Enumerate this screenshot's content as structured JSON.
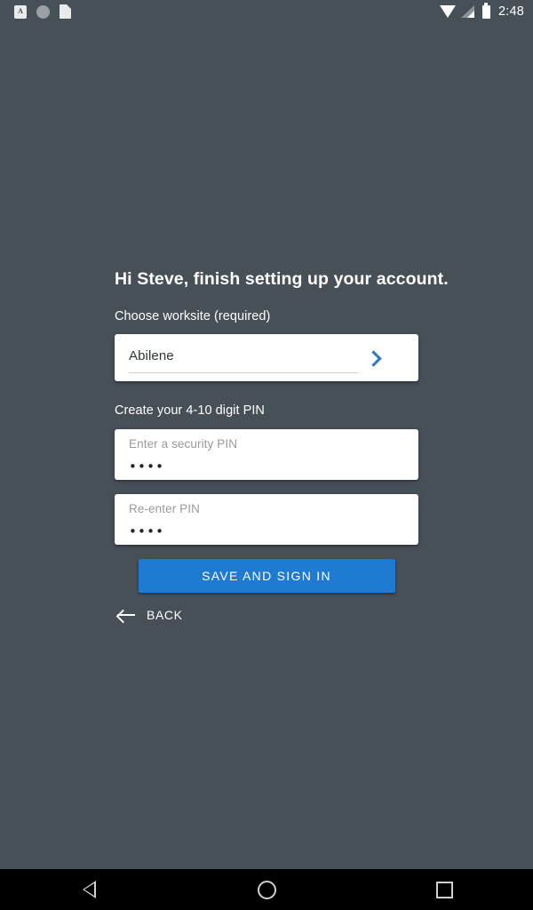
{
  "status_bar": {
    "left_icons": [
      {
        "name": "app-badge-a-icon",
        "glyph": "A"
      },
      {
        "name": "circle-notification-icon",
        "glyph": ""
      },
      {
        "name": "document-notification-icon",
        "glyph": ""
      }
    ],
    "right_icons": [
      {
        "name": "wifi-icon"
      },
      {
        "name": "cellular-signal-icon"
      },
      {
        "name": "battery-icon"
      }
    ],
    "time": "2:48"
  },
  "screen": {
    "title": "Hi Steve, finish setting up your account.",
    "worksite": {
      "label": "Choose worksite (required)",
      "value": "Abilene",
      "chevron_icon": "chevron-right-icon"
    },
    "pin": {
      "section_label": "Create your 4-10 digit PIN",
      "enter": {
        "hint": "Enter a security PIN",
        "masked_value": "••••"
      },
      "reenter": {
        "hint": "Re-enter PIN",
        "masked_value": "••••"
      }
    },
    "primary_button": "SAVE AND SIGN IN",
    "back_link": "BACK"
  },
  "nav_bar": {
    "back": "back-triangle-icon",
    "home": "home-circle-icon",
    "recents": "recents-square-icon"
  },
  "colors": {
    "background": "#474f57",
    "card": "#ffffff",
    "accent_blue": "#1f7ad1",
    "chevron_blue": "#2b76bd",
    "nav_bar": "#000000",
    "text_primary": "#ffffff",
    "text_field_value": "#2d3338",
    "text_hint": "#9a9a9a"
  }
}
